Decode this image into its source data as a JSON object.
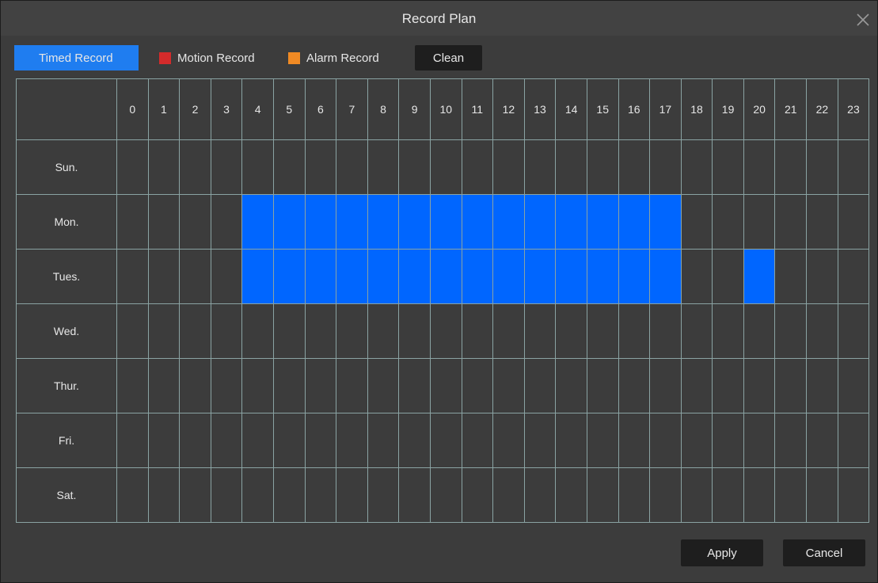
{
  "dialog": {
    "title": "Record Plan"
  },
  "toolbar": {
    "modes": [
      {
        "label": "Timed Record",
        "color": "#1f7df0",
        "active": true
      },
      {
        "label": "Motion Record",
        "color": "#d42b2b",
        "active": false
      },
      {
        "label": "Alarm Record",
        "color": "#f08a24",
        "active": false
      }
    ],
    "clean_label": "Clean"
  },
  "schedule": {
    "hours": [
      "0",
      "1",
      "2",
      "3",
      "4",
      "5",
      "6",
      "7",
      "8",
      "9",
      "10",
      "11",
      "12",
      "13",
      "14",
      "15",
      "16",
      "17",
      "18",
      "19",
      "20",
      "21",
      "22",
      "23"
    ],
    "days": [
      {
        "label": "Sun.",
        "timed_hours": []
      },
      {
        "label": "Mon.",
        "timed_hours": [
          4,
          5,
          6,
          7,
          8,
          9,
          10,
          11,
          12,
          13,
          14,
          15,
          16,
          17
        ]
      },
      {
        "label": "Tues.",
        "timed_hours": [
          4,
          5,
          6,
          7,
          8,
          9,
          10,
          11,
          12,
          13,
          14,
          15,
          16,
          17,
          20
        ]
      },
      {
        "label": "Wed.",
        "timed_hours": []
      },
      {
        "label": "Thur.",
        "timed_hours": []
      },
      {
        "label": "Fri.",
        "timed_hours": []
      },
      {
        "label": "Sat.",
        "timed_hours": []
      }
    ],
    "timed_color": "#0066ff"
  },
  "footer": {
    "apply_label": "Apply",
    "cancel_label": "Cancel"
  }
}
